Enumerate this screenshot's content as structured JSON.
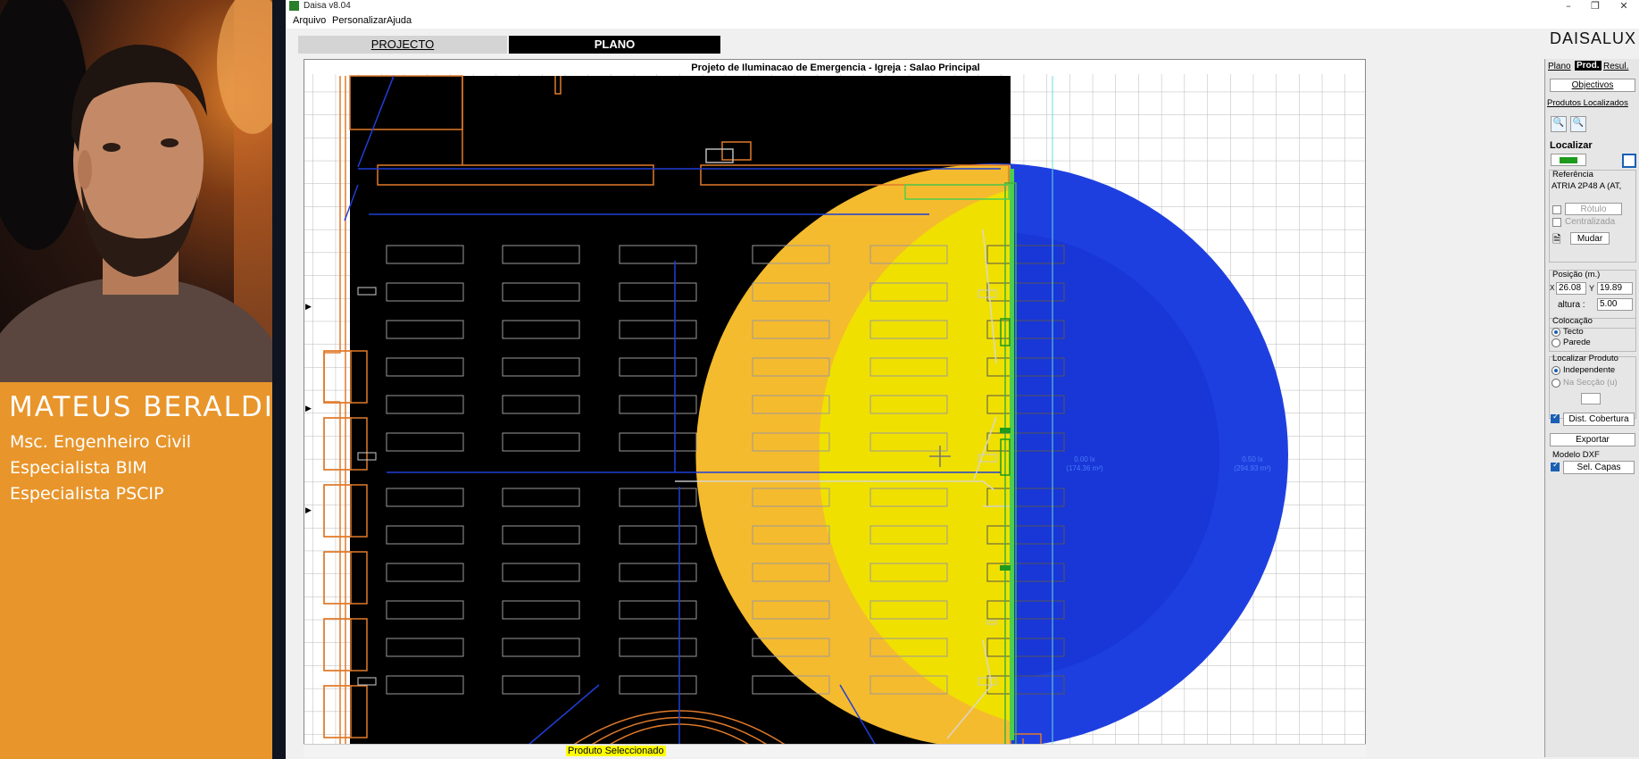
{
  "presenter": {
    "name": "MATEUS BERALDI",
    "credentials": [
      "Msc. Engenheiro Civil",
      "Especialista BIM",
      "Especialista PSCIP"
    ]
  },
  "window": {
    "title": "Daisa v8.04",
    "controls": {
      "minimize": "–",
      "maximize": "❐",
      "close": "✕"
    }
  },
  "menu": [
    "Arquivo",
    "Personalizar",
    "Ajuda"
  ],
  "tabs": {
    "projecto": "PROJECTO",
    "plano": "PLANO"
  },
  "brand": "DAISALUX",
  "plan": {
    "title": "Projeto de Iluminacao de Emergencia - Igreja : Salao Principal",
    "labels": [
      {
        "line1": "0.00 lx",
        "line2": "(174.36 m²)"
      },
      {
        "line1": "0.50 lx",
        "line2": "(294.93 m²)"
      }
    ]
  },
  "status": {
    "text": "Produto Seleccionado"
  },
  "panel": {
    "tabs": [
      "Plano",
      "Prod.",
      "Resul."
    ],
    "objectives": "Objectivos",
    "located_products": "Produtos Localizados",
    "localizar": "Localizar",
    "referencia_label": "Referência",
    "referencia_value": "ATRIA 2P48 A (AT,",
    "rotulo": "Rótulo",
    "centralizada": "Centralizada",
    "mudar": "Mudar",
    "posicao_label": "Posição (m.)",
    "x_label": "X",
    "x_value": "26.08",
    "y_label": "Y",
    "y_value": "19.89",
    "altura_label": "altura :",
    "altura_value": "5.00",
    "colocacao_label": "Colocação",
    "tecto": "Tecto",
    "parede": "Parede",
    "localizar_produto_label": "Localizar Produto",
    "independente": "Independente",
    "na_seccao": "Na Secção (u)",
    "dist_cobertura": "Dist. Cobertura",
    "exportar": "Exportar",
    "modelo_dxf": "Modelo DXF",
    "sel_capas": "Sel. Capas"
  },
  "colors": {
    "presenter_bg": "#e8952b",
    "plan_bg": "#000000",
    "coverage_yellow": "#f0e000",
    "coverage_orange": "#f5bb2e",
    "coverage_blue_outer": "#1e3fe0",
    "coverage_blue_inner": "#1531d0",
    "wall_orange": "#e07a2a",
    "active_tab": "#000000"
  }
}
